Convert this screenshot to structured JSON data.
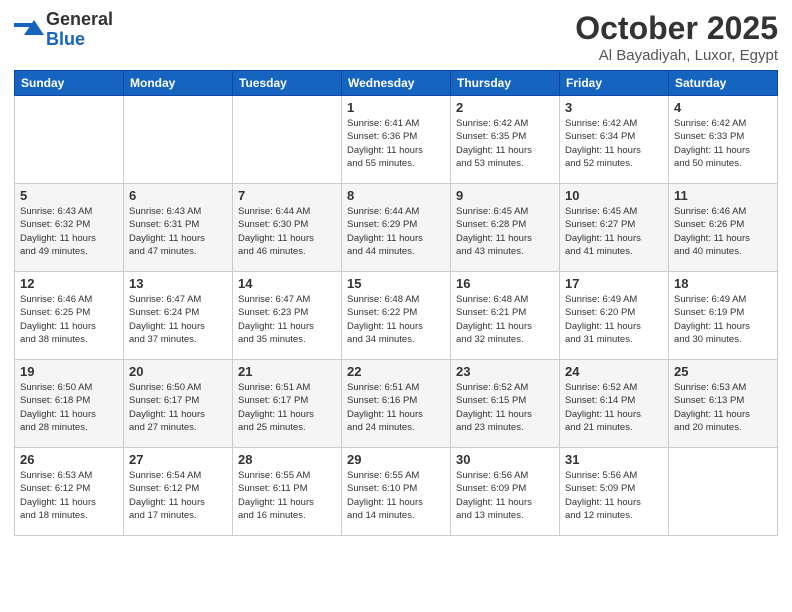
{
  "header": {
    "logo_general": "General",
    "logo_blue": "Blue",
    "month_title": "October 2025",
    "location": "Al Bayadiyah, Luxor, Egypt"
  },
  "weekdays": [
    "Sunday",
    "Monday",
    "Tuesday",
    "Wednesday",
    "Thursday",
    "Friday",
    "Saturday"
  ],
  "weeks": [
    [
      {
        "day": "",
        "info": ""
      },
      {
        "day": "",
        "info": ""
      },
      {
        "day": "",
        "info": ""
      },
      {
        "day": "1",
        "info": "Sunrise: 6:41 AM\nSunset: 6:36 PM\nDaylight: 11 hours\nand 55 minutes."
      },
      {
        "day": "2",
        "info": "Sunrise: 6:42 AM\nSunset: 6:35 PM\nDaylight: 11 hours\nand 53 minutes."
      },
      {
        "day": "3",
        "info": "Sunrise: 6:42 AM\nSunset: 6:34 PM\nDaylight: 11 hours\nand 52 minutes."
      },
      {
        "day": "4",
        "info": "Sunrise: 6:42 AM\nSunset: 6:33 PM\nDaylight: 11 hours\nand 50 minutes."
      }
    ],
    [
      {
        "day": "5",
        "info": "Sunrise: 6:43 AM\nSunset: 6:32 PM\nDaylight: 11 hours\nand 49 minutes."
      },
      {
        "day": "6",
        "info": "Sunrise: 6:43 AM\nSunset: 6:31 PM\nDaylight: 11 hours\nand 47 minutes."
      },
      {
        "day": "7",
        "info": "Sunrise: 6:44 AM\nSunset: 6:30 PM\nDaylight: 11 hours\nand 46 minutes."
      },
      {
        "day": "8",
        "info": "Sunrise: 6:44 AM\nSunset: 6:29 PM\nDaylight: 11 hours\nand 44 minutes."
      },
      {
        "day": "9",
        "info": "Sunrise: 6:45 AM\nSunset: 6:28 PM\nDaylight: 11 hours\nand 43 minutes."
      },
      {
        "day": "10",
        "info": "Sunrise: 6:45 AM\nSunset: 6:27 PM\nDaylight: 11 hours\nand 41 minutes."
      },
      {
        "day": "11",
        "info": "Sunrise: 6:46 AM\nSunset: 6:26 PM\nDaylight: 11 hours\nand 40 minutes."
      }
    ],
    [
      {
        "day": "12",
        "info": "Sunrise: 6:46 AM\nSunset: 6:25 PM\nDaylight: 11 hours\nand 38 minutes."
      },
      {
        "day": "13",
        "info": "Sunrise: 6:47 AM\nSunset: 6:24 PM\nDaylight: 11 hours\nand 37 minutes."
      },
      {
        "day": "14",
        "info": "Sunrise: 6:47 AM\nSunset: 6:23 PM\nDaylight: 11 hours\nand 35 minutes."
      },
      {
        "day": "15",
        "info": "Sunrise: 6:48 AM\nSunset: 6:22 PM\nDaylight: 11 hours\nand 34 minutes."
      },
      {
        "day": "16",
        "info": "Sunrise: 6:48 AM\nSunset: 6:21 PM\nDaylight: 11 hours\nand 32 minutes."
      },
      {
        "day": "17",
        "info": "Sunrise: 6:49 AM\nSunset: 6:20 PM\nDaylight: 11 hours\nand 31 minutes."
      },
      {
        "day": "18",
        "info": "Sunrise: 6:49 AM\nSunset: 6:19 PM\nDaylight: 11 hours\nand 30 minutes."
      }
    ],
    [
      {
        "day": "19",
        "info": "Sunrise: 6:50 AM\nSunset: 6:18 PM\nDaylight: 11 hours\nand 28 minutes."
      },
      {
        "day": "20",
        "info": "Sunrise: 6:50 AM\nSunset: 6:17 PM\nDaylight: 11 hours\nand 27 minutes."
      },
      {
        "day": "21",
        "info": "Sunrise: 6:51 AM\nSunset: 6:17 PM\nDaylight: 11 hours\nand 25 minutes."
      },
      {
        "day": "22",
        "info": "Sunrise: 6:51 AM\nSunset: 6:16 PM\nDaylight: 11 hours\nand 24 minutes."
      },
      {
        "day": "23",
        "info": "Sunrise: 6:52 AM\nSunset: 6:15 PM\nDaylight: 11 hours\nand 23 minutes."
      },
      {
        "day": "24",
        "info": "Sunrise: 6:52 AM\nSunset: 6:14 PM\nDaylight: 11 hours\nand 21 minutes."
      },
      {
        "day": "25",
        "info": "Sunrise: 6:53 AM\nSunset: 6:13 PM\nDaylight: 11 hours\nand 20 minutes."
      }
    ],
    [
      {
        "day": "26",
        "info": "Sunrise: 6:53 AM\nSunset: 6:12 PM\nDaylight: 11 hours\nand 18 minutes."
      },
      {
        "day": "27",
        "info": "Sunrise: 6:54 AM\nSunset: 6:12 PM\nDaylight: 11 hours\nand 17 minutes."
      },
      {
        "day": "28",
        "info": "Sunrise: 6:55 AM\nSunset: 6:11 PM\nDaylight: 11 hours\nand 16 minutes."
      },
      {
        "day": "29",
        "info": "Sunrise: 6:55 AM\nSunset: 6:10 PM\nDaylight: 11 hours\nand 14 minutes."
      },
      {
        "day": "30",
        "info": "Sunrise: 6:56 AM\nSunset: 6:09 PM\nDaylight: 11 hours\nand 13 minutes."
      },
      {
        "day": "31",
        "info": "Sunrise: 5:56 AM\nSunset: 5:09 PM\nDaylight: 11 hours\nand 12 minutes."
      },
      {
        "day": "",
        "info": ""
      }
    ]
  ]
}
